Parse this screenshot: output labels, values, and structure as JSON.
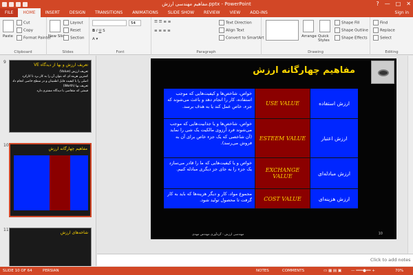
{
  "window": {
    "title": "مفاهیم مهندسی ارزش.pptx - PowerPoint",
    "controls": [
      "?",
      "—",
      "□",
      "✕"
    ]
  },
  "tabs": [
    {
      "label": "FILE"
    },
    {
      "label": "HOME"
    },
    {
      "label": "INSERT"
    },
    {
      "label": "DESIGN"
    },
    {
      "label": "TRANSITIONS"
    },
    {
      "label": "ANIMATIONS"
    },
    {
      "label": "SLIDE SHOW"
    },
    {
      "label": "REVIEW"
    },
    {
      "label": "VIEW"
    },
    {
      "label": "ADD-INS"
    }
  ],
  "sign_in": "Sign in",
  "ribbon": {
    "clipboard": {
      "paste": "Paste",
      "cut": "Cut",
      "copy": "Copy",
      "format_painter": "Format Painter",
      "label": "Clipboard"
    },
    "slides": {
      "new_slide": "New Slide",
      "layout": "Layout",
      "reset": "Reset",
      "section": "Section",
      "label": "Slides"
    },
    "font": {
      "font_size": "54",
      "label": "Font"
    },
    "paragraph": {
      "text_direction": "Text Direction",
      "align_text": "Align Text",
      "smartart": "Convert to SmartArt",
      "label": "Paragraph"
    },
    "drawing": {
      "arrange": "Arrange",
      "quick_styles": "Quick Styles",
      "shape_fill": "Shape Fill",
      "shape_outline": "Shape Outline",
      "shape_effects": "Shape Effects",
      "label": "Drawing"
    },
    "editing": {
      "find": "Find",
      "replace": "Replace",
      "select": "Select",
      "label": "Editing"
    }
  },
  "thumbnails": [
    {
      "num": "9",
      "title": "تعریف ارزش و بها از دیدگاه VE",
      "lines": [
        "تعریف ارزش (Value)",
        "کمترین هزینه ای که بتوان آن را به کار برد تا کارکرد",
        "اصلی را با کیفیت قابل اطمینان و در سطح خاصی انجام داد",
        "تعریف بها (Worth)",
        "قیمتی که متقاضی با دیدگاه مشتری دارد"
      ]
    },
    {
      "num": "10",
      "title": "مفاهیم چهارگانه ارزش",
      "lines": []
    },
    {
      "num": "11",
      "title": "شاخه‌های ارزش",
      "lines": []
    }
  ],
  "slide": {
    "title": "مفاهیم چهارگانه ارزش",
    "rows": [
      {
        "label": "ارزش استفاده",
        "term": "USE VALUE",
        "desc": "خواص، شاخص‌ها و کیفیت‌هایی که موجب استفاده، کار را انجام دهد و باعث می‌شوند که جزء، خاص عمل کند یا به هدف برسد."
      },
      {
        "label": "ارزش اعتبار",
        "term": "ESTEEM VALUE",
        "desc": "خواص، شاخص‌ها و یا جذابیت‌هایی که موجب می‌شوند فرد آرزوی مالکیت یک شی را نماید (آن شاخصی که یک جزء خاص برای آن به فروش می‌رسد)."
      },
      {
        "label": "ارزش مبادله‌ای",
        "term": "EXCHANGE VALUE",
        "desc": "خواص و یا کیفیت‌هایی که ما را قادر می‌سازد یک جزء را به جای جز دیگری مبادله کنیم."
      },
      {
        "label": "ارزش هزینه‌ای",
        "term": "COST VALUE",
        "desc": "مجموع مواد، کار و دیگر هزینه‌ها که باید به کار گرفت تا محصول تولید شود."
      }
    ],
    "footer": "مهندسی ارزش - گردآوری مهندس مهدی",
    "number": "10"
  },
  "notes_placeholder": "Click to add notes",
  "status": {
    "slide": "SLIDE 10 OF 64",
    "language": "PERSIAN",
    "notes": "NOTES",
    "comments": "COMMENTS",
    "zoom": "70%"
  }
}
